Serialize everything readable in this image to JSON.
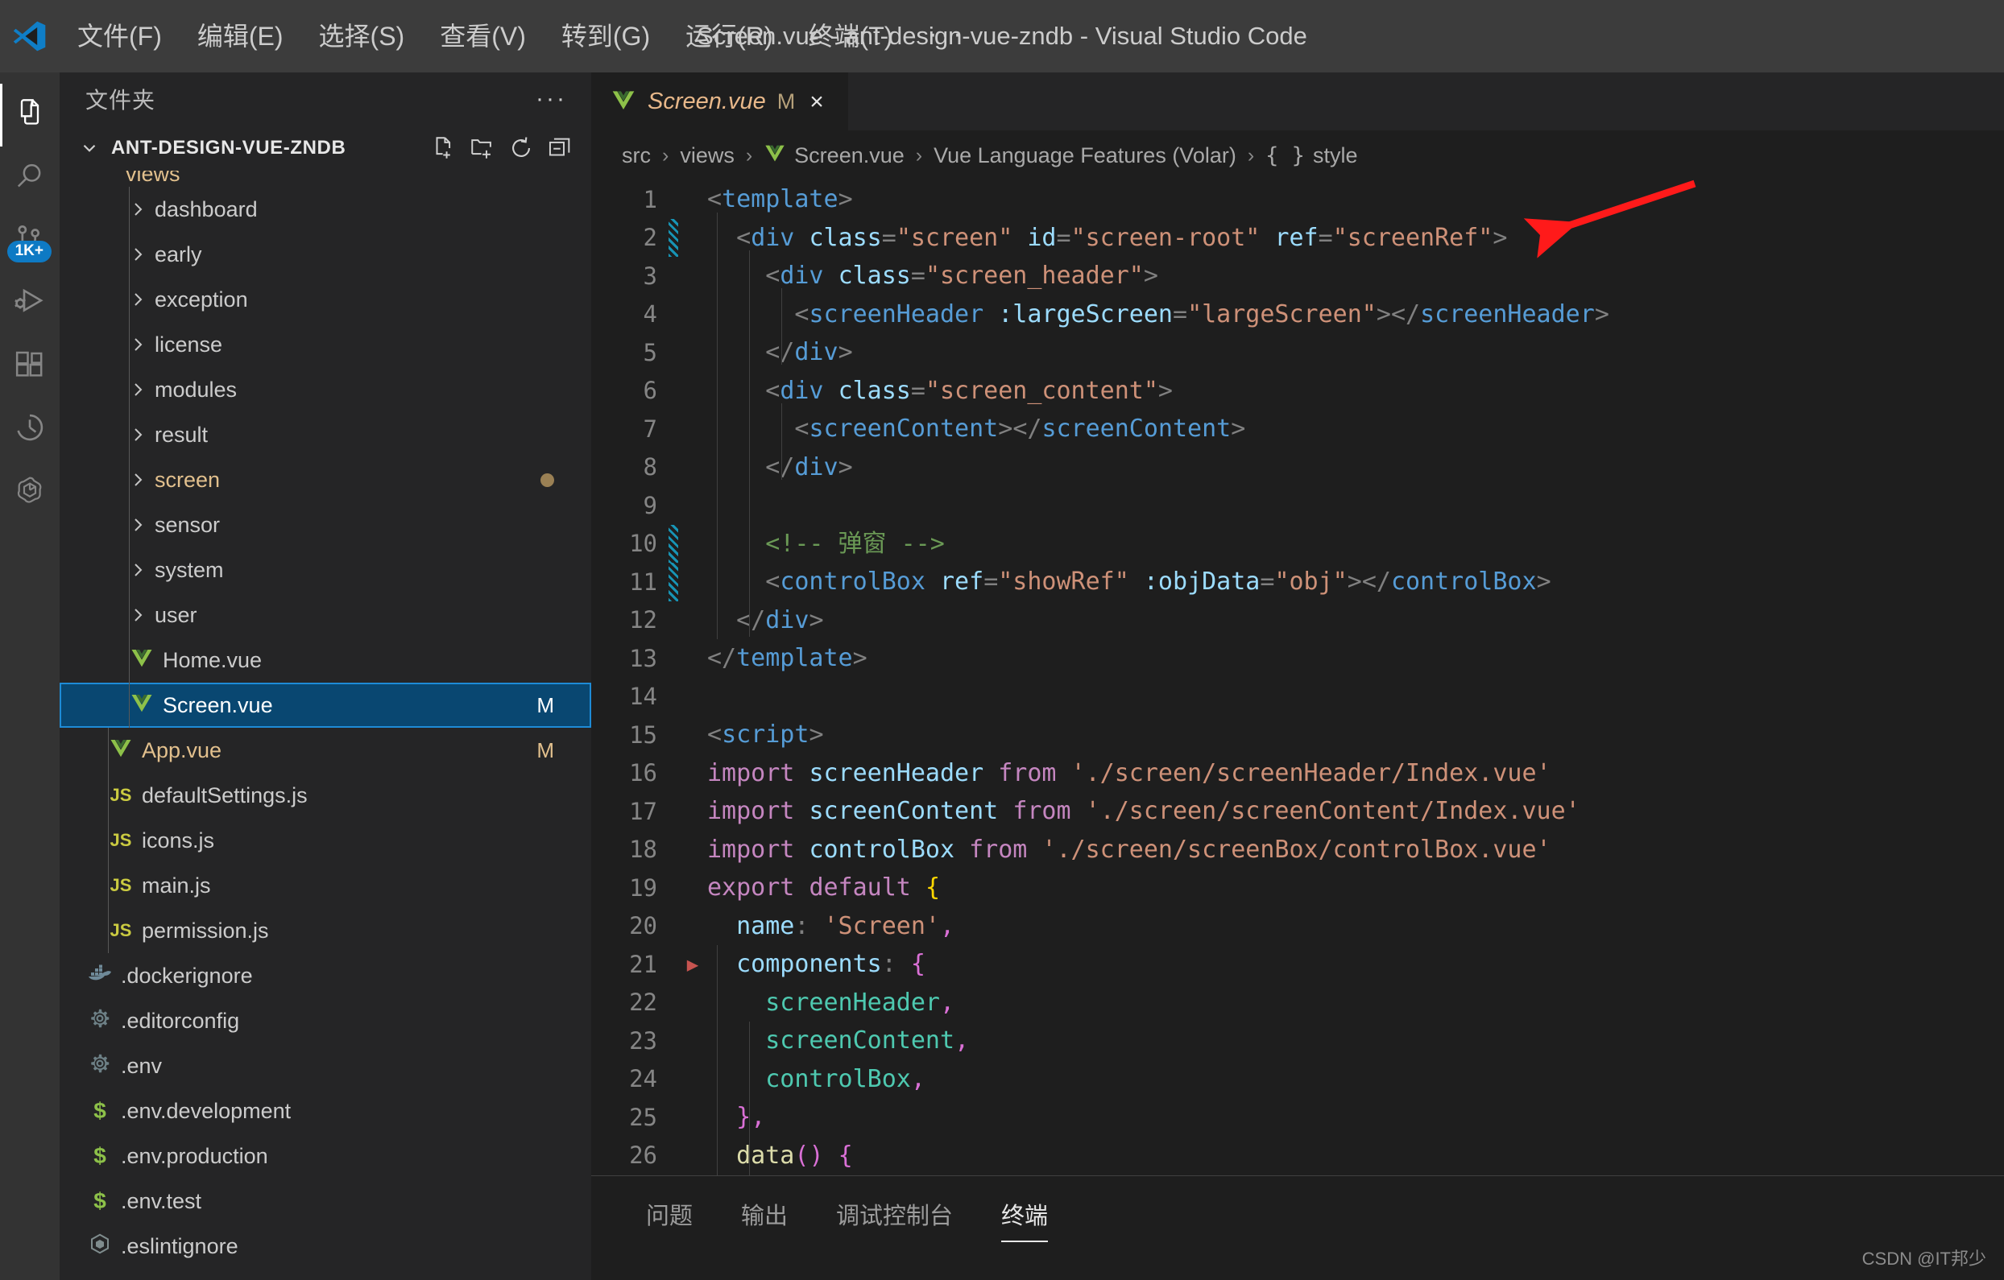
{
  "window": {
    "title": "Screen.vue - ant-design-vue-zndb - Visual Studio Code",
    "logo_name": "vscode-logo"
  },
  "menubar": {
    "items": [
      {
        "label": "文件(F)"
      },
      {
        "label": "编辑(E)"
      },
      {
        "label": "选择(S)"
      },
      {
        "label": "查看(V)"
      },
      {
        "label": "转到(G)"
      },
      {
        "label": "运行(R)"
      },
      {
        "label": "终端(T)"
      },
      {
        "label": "···"
      }
    ]
  },
  "activitybar": {
    "items": [
      {
        "name": "explorer",
        "icon": "files-icon",
        "active": true,
        "badge": ""
      },
      {
        "name": "search",
        "icon": "search-icon",
        "active": false,
        "badge": ""
      },
      {
        "name": "source-control",
        "icon": "source-control-icon",
        "active": false,
        "badge": "1K+"
      },
      {
        "name": "run-and-debug",
        "icon": "run-debug-icon",
        "active": false,
        "badge": ""
      },
      {
        "name": "extensions",
        "icon": "extensions-icon",
        "active": false,
        "badge": ""
      },
      {
        "name": "timeline",
        "icon": "clock-icon",
        "active": false,
        "badge": ""
      },
      {
        "name": "chatgpt",
        "icon": "openai-icon",
        "active": false,
        "badge": ""
      }
    ]
  },
  "sidebar": {
    "title": "文件夹",
    "more_label": "···",
    "project": {
      "name": "ANT-DESIGN-VUE-ZNDB",
      "expanded": true,
      "actions": [
        {
          "label": "新建文件",
          "icon": "new-file-icon"
        },
        {
          "label": "新建文件夹",
          "icon": "new-folder-icon"
        },
        {
          "label": "刷新",
          "icon": "refresh-icon"
        },
        {
          "label": "全部折叠",
          "icon": "collapse-all-icon"
        }
      ]
    },
    "partial_row": {
      "label": "views",
      "type": "folder"
    },
    "tree": [
      {
        "label": "dashboard",
        "type": "folder",
        "indent": 2,
        "badge": "",
        "dot": false,
        "selected": false
      },
      {
        "label": "early",
        "type": "folder",
        "indent": 2,
        "badge": "",
        "dot": false,
        "selected": false
      },
      {
        "label": "exception",
        "type": "folder",
        "indent": 2,
        "badge": "",
        "dot": false,
        "selected": false
      },
      {
        "label": "license",
        "type": "folder",
        "indent": 2,
        "badge": "",
        "dot": false,
        "selected": false
      },
      {
        "label": "modules",
        "type": "folder",
        "indent": 2,
        "badge": "",
        "dot": false,
        "selected": false
      },
      {
        "label": "result",
        "type": "folder",
        "indent": 2,
        "badge": "",
        "dot": false,
        "selected": false
      },
      {
        "label": "screen",
        "type": "folder",
        "indent": 2,
        "badge": "",
        "dot": true,
        "selected": false,
        "modified": true
      },
      {
        "label": "sensor",
        "type": "folder",
        "indent": 2,
        "badge": "",
        "dot": false,
        "selected": false
      },
      {
        "label": "system",
        "type": "folder",
        "indent": 2,
        "badge": "",
        "dot": false,
        "selected": false
      },
      {
        "label": "user",
        "type": "folder",
        "indent": 2,
        "badge": "",
        "dot": false,
        "selected": false
      },
      {
        "label": "Home.vue",
        "type": "vue",
        "indent": 2,
        "badge": "",
        "dot": false,
        "selected": false
      },
      {
        "label": "Screen.vue",
        "type": "vue",
        "indent": 2,
        "badge": "M",
        "dot": false,
        "selected": true,
        "modified": true
      },
      {
        "label": "App.vue",
        "type": "vue",
        "indent": 1,
        "badge": "M",
        "dot": false,
        "selected": false,
        "modified": true
      },
      {
        "label": "defaultSettings.js",
        "type": "js",
        "indent": 1,
        "badge": "",
        "dot": false,
        "selected": false
      },
      {
        "label": "icons.js",
        "type": "js",
        "indent": 1,
        "badge": "",
        "dot": false,
        "selected": false
      },
      {
        "label": "main.js",
        "type": "js",
        "indent": 1,
        "badge": "",
        "dot": false,
        "selected": false
      },
      {
        "label": "permission.js",
        "type": "js",
        "indent": 1,
        "badge": "",
        "dot": false,
        "selected": false
      },
      {
        "label": ".dockerignore",
        "type": "docker",
        "indent": 0,
        "badge": "",
        "dot": false,
        "selected": false
      },
      {
        "label": ".editorconfig",
        "type": "gear",
        "indent": 0,
        "badge": "",
        "dot": false,
        "selected": false
      },
      {
        "label": ".env",
        "type": "gear",
        "indent": 0,
        "badge": "",
        "dot": false,
        "selected": false
      },
      {
        "label": ".env.development",
        "type": "env",
        "indent": 0,
        "badge": "",
        "dot": false,
        "selected": false
      },
      {
        "label": ".env.production",
        "type": "env",
        "indent": 0,
        "badge": "",
        "dot": false,
        "selected": false
      },
      {
        "label": ".env.test",
        "type": "env",
        "indent": 0,
        "badge": "",
        "dot": false,
        "selected": false
      },
      {
        "label": ".eslintignore",
        "type": "eslint",
        "indent": 0,
        "badge": "",
        "dot": false,
        "selected": false
      }
    ]
  },
  "editor": {
    "tabs": [
      {
        "label": "Screen.vue",
        "badge": "M",
        "icon": "vue-icon",
        "close": "×",
        "active": true
      }
    ],
    "breadcrumb": [
      {
        "label": "src",
        "icon": ""
      },
      {
        "label": "views",
        "icon": ""
      },
      {
        "label": "Screen.vue",
        "icon": "vue-icon"
      },
      {
        "label": "Vue Language Features (Volar)",
        "icon": ""
      },
      {
        "label": "style",
        "icon": "braces"
      }
    ],
    "breadcrumb_separator": "›",
    "lines": [
      {
        "n": 1,
        "git": "",
        "fold": ""
      },
      {
        "n": 2,
        "git": "mod",
        "fold": ""
      },
      {
        "n": 3,
        "git": "",
        "fold": ""
      },
      {
        "n": 4,
        "git": "",
        "fold": ""
      },
      {
        "n": 5,
        "git": "",
        "fold": ""
      },
      {
        "n": 6,
        "git": "",
        "fold": ""
      },
      {
        "n": 7,
        "git": "",
        "fold": ""
      },
      {
        "n": 8,
        "git": "",
        "fold": ""
      },
      {
        "n": 9,
        "git": "",
        "fold": ""
      },
      {
        "n": 10,
        "git": "mod",
        "fold": ""
      },
      {
        "n": 11,
        "git": "mod",
        "fold": ""
      },
      {
        "n": 12,
        "git": "",
        "fold": ""
      },
      {
        "n": 13,
        "git": "",
        "fold": ""
      },
      {
        "n": 14,
        "git": "",
        "fold": ""
      },
      {
        "n": 15,
        "git": "",
        "fold": ""
      },
      {
        "n": 16,
        "git": "",
        "fold": ""
      },
      {
        "n": 17,
        "git": "",
        "fold": ""
      },
      {
        "n": 18,
        "git": "",
        "fold": ""
      },
      {
        "n": 19,
        "git": "",
        "fold": ""
      },
      {
        "n": 20,
        "git": "",
        "fold": ""
      },
      {
        "n": 21,
        "git": "",
        "fold": "▶"
      },
      {
        "n": 22,
        "git": "",
        "fold": ""
      },
      {
        "n": 23,
        "git": "",
        "fold": ""
      },
      {
        "n": 24,
        "git": "",
        "fold": ""
      },
      {
        "n": 25,
        "git": "",
        "fold": ""
      },
      {
        "n": 26,
        "git": "",
        "fold": ""
      }
    ],
    "source_text": [
      "<template>",
      "  <div class=\"screen\" id=\"screen-root\" ref=\"screenRef\">",
      "    <div class=\"screen_header\">",
      "      <screenHeader :largeScreen=\"largeScreen\"></screenHeader>",
      "    </div>",
      "    <div class=\"screen_content\">",
      "      <screenContent></screenContent>",
      "    </div>",
      "",
      "    <!-- 弹窗 -->",
      "    <controlBox ref=\"showRef\" :objData=\"obj\"></controlBox>",
      "  </div>",
      "</template>",
      "",
      "<script>",
      "import screenHeader from './screen/screenHeader/Index.vue'",
      "import screenContent from './screen/screenContent/Index.vue'",
      "import controlBox from './screen/screenBox/controlBox.vue'",
      "export default {",
      "  name: 'Screen',",
      "  components: {",
      "    screenHeader,",
      "    screenContent,",
      "    controlBox,",
      "  },",
      "  data() {"
    ]
  },
  "panel": {
    "tabs": [
      {
        "label": "问题",
        "active": false
      },
      {
        "label": "输出",
        "active": false
      },
      {
        "label": "调试控制台",
        "active": false
      },
      {
        "label": "终端",
        "active": true
      }
    ]
  },
  "annotations": {
    "arrow_color": "#ff1a1a",
    "watermark": "CSDN @IT邦少"
  },
  "colors": {
    "accent_blue": "#0e7ac4",
    "selection_blue": "#094771",
    "selection_border": "#1e8bd6",
    "modified_orange": "#e2c08d",
    "vue_green": "#8dc149",
    "titlebar_bg": "#3c3c3c",
    "sidebar_bg": "#252526",
    "editor_bg": "#1e1e1e"
  }
}
